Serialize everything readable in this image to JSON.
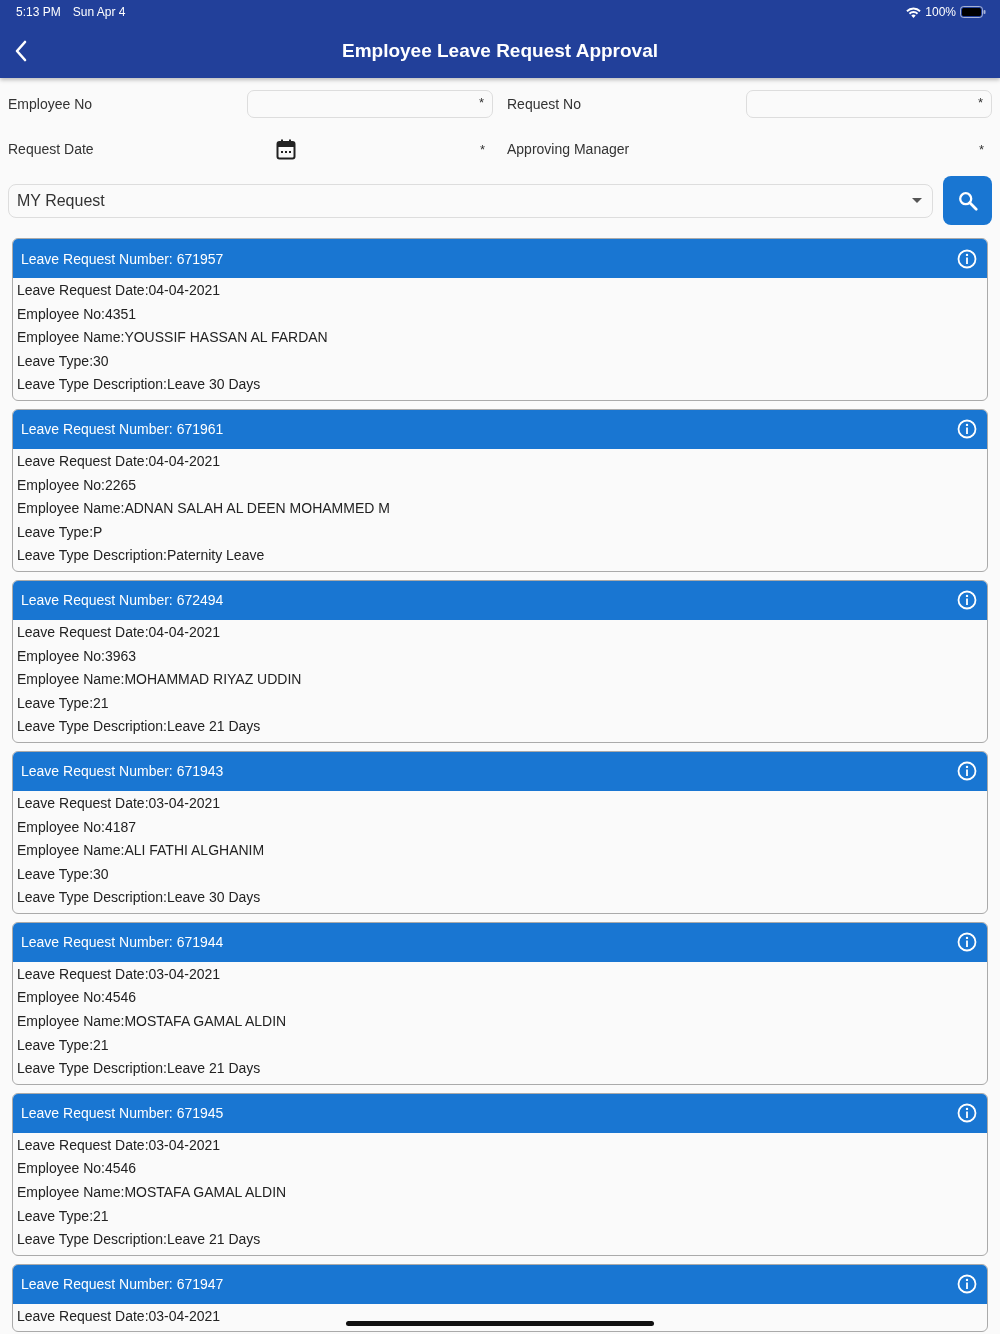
{
  "status_bar": {
    "time": "5:13 PM",
    "date": "Sun Apr 4",
    "battery": "100%"
  },
  "app_bar": {
    "title": "Employee Leave Request Approval"
  },
  "filters": [
    {
      "kind": "input",
      "label": "Employee No",
      "required_mark": "*"
    },
    {
      "kind": "input",
      "label": "Request No",
      "required_mark": "*"
    },
    {
      "kind": "date",
      "label": "Request Date",
      "required_mark": "*"
    },
    {
      "kind": "text",
      "label": "Approving Manager",
      "required_mark": "*"
    }
  ],
  "dropdown": {
    "value": "MY Request"
  },
  "requests": [
    {
      "title": "Leave Request Number: 671957",
      "lines": [
        "Leave Request Date:04-04-2021",
        "Employee No:4351",
        "Employee Name:YOUSSIF HASSAN AL FARDAN",
        "Leave Type:30",
        "Leave Type Description:Leave 30 Days"
      ]
    },
    {
      "title": "Leave Request Number: 671961",
      "lines": [
        "Leave Request Date:04-04-2021",
        "Employee No:2265",
        "Employee Name:ADNAN SALAH AL DEEN MOHAMMED M",
        "Leave Type:P",
        "Leave Type Description:Paternity Leave"
      ]
    },
    {
      "title": "Leave Request Number: 672494",
      "lines": [
        "Leave Request Date:04-04-2021",
        "Employee No:3963",
        "Employee Name:MOHAMMAD RIYAZ UDDIN",
        "Leave Type:21",
        "Leave Type Description:Leave 21 Days"
      ]
    },
    {
      "title": "Leave Request Number: 671943",
      "lines": [
        "Leave Request Date:03-04-2021",
        "Employee No:4187",
        "Employee Name:ALI FATHI ALGHANIM",
        "Leave Type:30",
        "Leave Type Description:Leave 30 Days"
      ]
    },
    {
      "title": "Leave Request Number: 671944",
      "lines": [
        "Leave Request Date:03-04-2021",
        "Employee No:4546",
        "Employee Name:MOSTAFA GAMAL ALDIN",
        "Leave Type:21",
        "Leave Type Description:Leave 21 Days"
      ]
    },
    {
      "title": "Leave Request Number: 671945",
      "lines": [
        "Leave Request Date:03-04-2021",
        "Employee No:4546",
        "Employee Name:MOSTAFA GAMAL ALDIN",
        "Leave Type:21",
        "Leave Type Description:Leave 21 Days"
      ]
    },
    {
      "title": "Leave Request Number: 671947",
      "lines": [
        "Leave Request Date:03-04-2021"
      ]
    }
  ]
}
